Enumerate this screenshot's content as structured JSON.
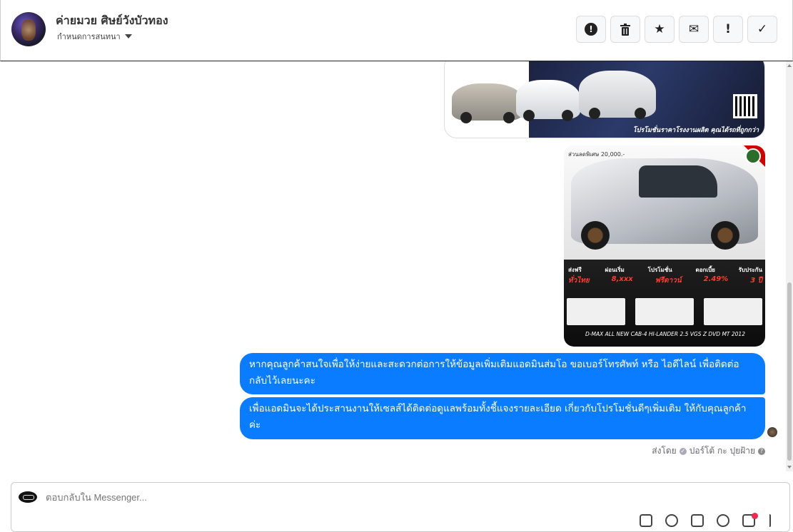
{
  "header": {
    "page_name": "ค่ายมวย ศิษย์วังบัวทอง",
    "assign_label": "กำหนดการสนทนา",
    "actions": [
      {
        "icon": "alert-circle-icon",
        "glyph": "!"
      },
      {
        "icon": "trash-icon",
        "glyph": "🗑"
      },
      {
        "icon": "star-icon",
        "glyph": "★"
      },
      {
        "icon": "envelope-icon",
        "glyph": "✉"
      },
      {
        "icon": "exclamation-icon",
        "glyph": "!"
      },
      {
        "icon": "check-icon",
        "glyph": "✓"
      }
    ]
  },
  "thread": {
    "promo1": {
      "caption": "โปรโมชั่นราคาโรงงานผลิต คุณได้รถที่ถูกกว่า"
    },
    "promo2": {
      "price_tag": "ส่วนลดพิเศษ 20,000.-",
      "labels": [
        "ส่งฟรี",
        "ผ่อนเริ่ม",
        "โปรโมชั่น",
        "ดอกเบี้ย",
        "รับประกัน"
      ],
      "values": [
        "ทั่วไทย",
        "8,xxx",
        "ฟรีดาวน์",
        "2.49%",
        "3 ปี"
      ],
      "model": "D-MAX ALL NEW CAB-4 HI-LANDER 2.5 VGS Z DVD MT 2012"
    },
    "messages": [
      {
        "text": "หากคุณลูกค้าสนใจเพื่อให้ง่ายและสะดวกต่อการให้ข้อมูลเพิ่มเติมแอดมินส่มโอ ขอเบอร์โทรศัพท์ หรือ ไอดีไลน์ เพื่อติดต่อกลับไว้เลยนะคะ"
      },
      {
        "text": "เพื่อแอดมินจะได้ประสานงานให้เซลส์ได้ติดต่อดูแลพร้อมทั้งชี้แจงรายละเอียด เกี่ยวกับโปรโมชั่นดีๆเพิ่มเติม ให้กับคุณลูกค้าค่ะ"
      }
    ],
    "sent_by_prefix": "ส่งโดย",
    "sent_by_name": "ปอร์โต้ กะ ปุยฝ้าย"
  },
  "composer": {
    "placeholder": "ตอบกลับใน Messenger..."
  },
  "colors": {
    "bubble": "#0a7cff",
    "notification": "#f02849"
  }
}
